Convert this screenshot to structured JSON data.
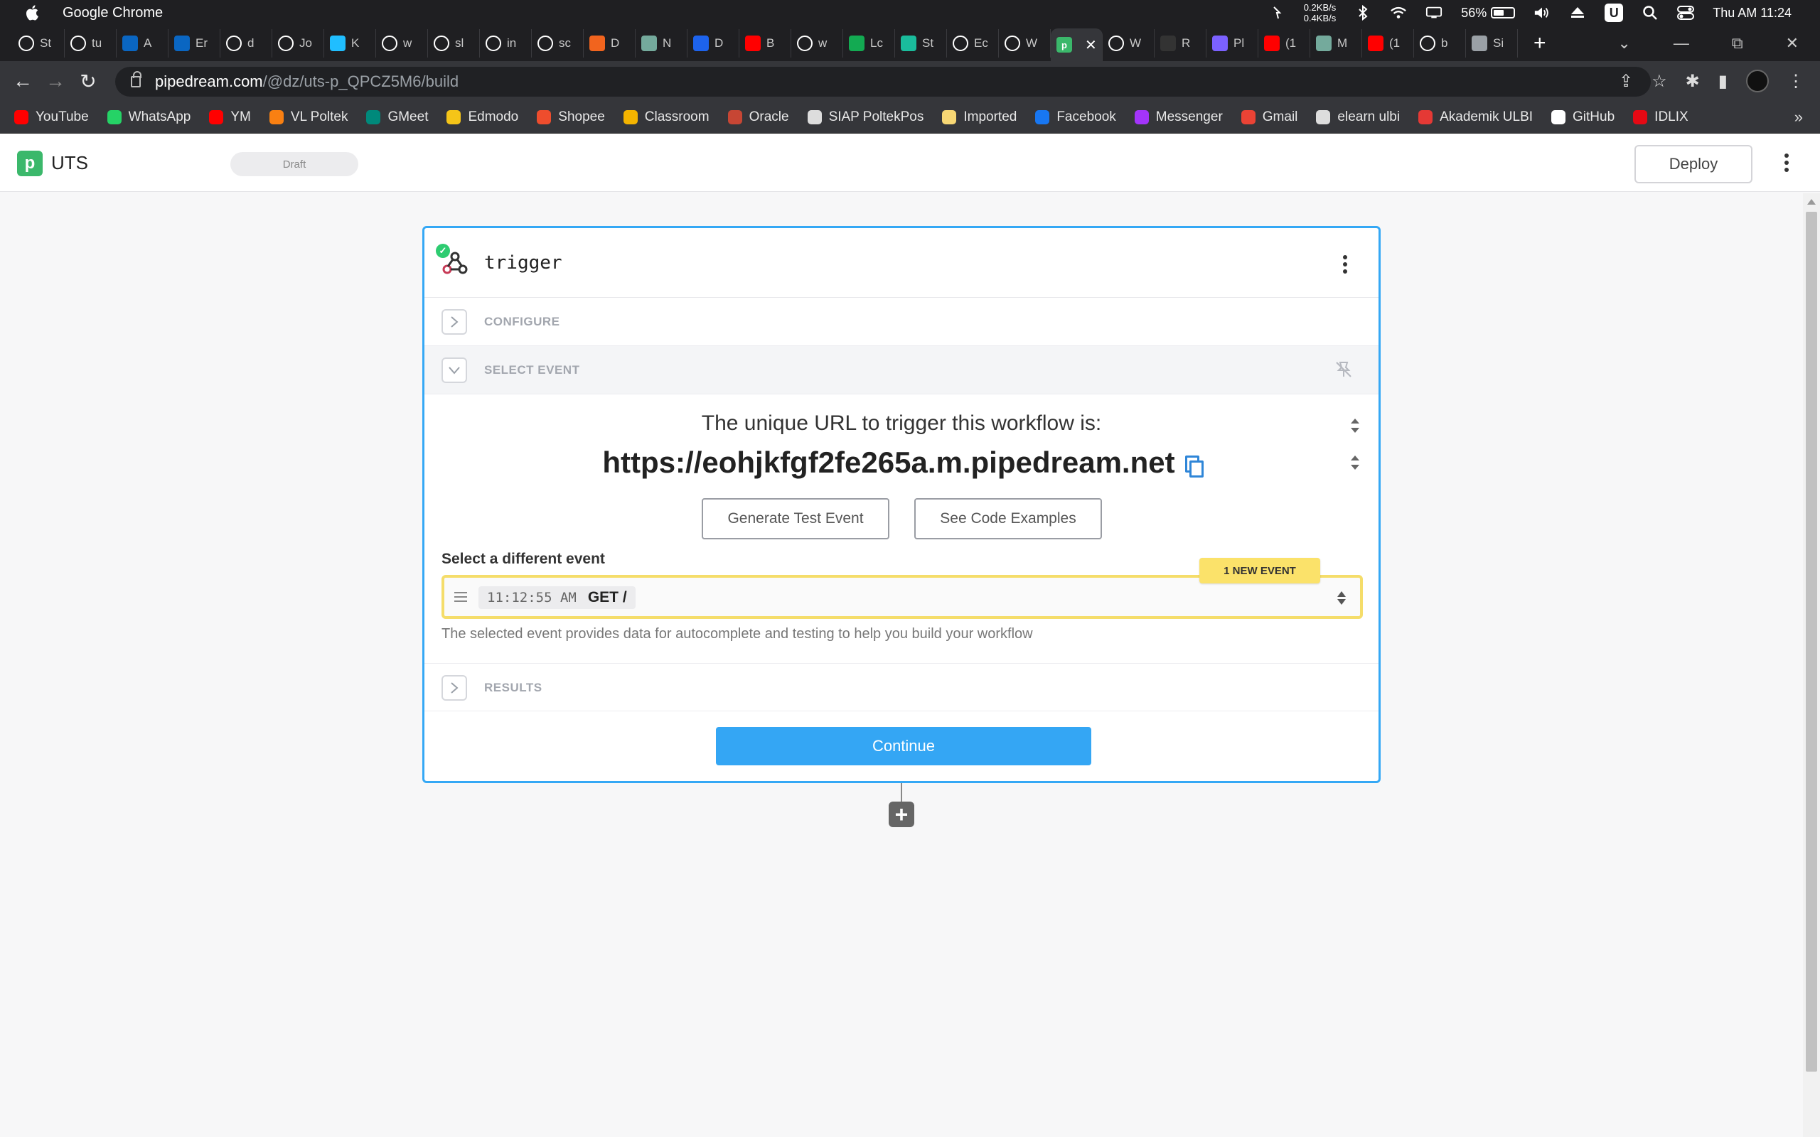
{
  "menubar": {
    "app_name": "Google Chrome",
    "net_up": "0.2KB/s",
    "net_down": "0.4KB/s",
    "battery": "56%",
    "clock": "Thu AM 11:24"
  },
  "tabs": [
    {
      "label": "St",
      "icon": "medium-icon",
      "color": "#ffffff"
    },
    {
      "label": "tu",
      "icon": "github-icon",
      "color": "#ffffff"
    },
    {
      "label": "A",
      "icon": "linkedin-icon",
      "color": "#0a66c2"
    },
    {
      "label": "Er",
      "icon": "linkedin-icon",
      "color": "#0a66c2"
    },
    {
      "label": "d",
      "icon": "github-icon",
      "color": "#ffffff"
    },
    {
      "label": "Jo",
      "icon": "github-icon",
      "color": "#ffffff"
    },
    {
      "label": "K",
      "icon": "kaggle-icon",
      "color": "#20beff"
    },
    {
      "label": "w",
      "icon": "github-icon",
      "color": "#ffffff"
    },
    {
      "label": "sl",
      "icon": "google-icon",
      "color": "#ffffff"
    },
    {
      "label": "in",
      "icon": "github-icon",
      "color": "#ffffff"
    },
    {
      "label": "sc",
      "icon": "google-icon",
      "color": "#ffffff"
    },
    {
      "label": "D",
      "icon": "etsy-icon",
      "color": "#f1641e"
    },
    {
      "label": "N",
      "icon": "openai-icon",
      "color": "#74aa9c"
    },
    {
      "label": "D",
      "icon": "docker-icon",
      "color": "#1d63ed"
    },
    {
      "label": "B",
      "icon": "youtube-icon",
      "color": "#ff0000"
    },
    {
      "label": "w",
      "icon": "github-icon",
      "color": "#ffffff"
    },
    {
      "label": "Lc",
      "icon": "leaf-icon",
      "color": "#13aa52"
    },
    {
      "label": "St",
      "icon": "diamond-icon",
      "color": "#1abc9c"
    },
    {
      "label": "Ec",
      "icon": "github-icon",
      "color": "#ffffff"
    },
    {
      "label": "W",
      "icon": "github-icon",
      "color": "#ffffff"
    },
    {
      "label": "",
      "icon": "pipedream-icon",
      "color": "#3bb86b"
    },
    {
      "label": "W",
      "icon": "github-icon",
      "color": "#ffffff"
    },
    {
      "label": "R",
      "icon": "circle-icon",
      "color": "#333333"
    },
    {
      "label": "Pl",
      "icon": "planet-icon",
      "color": "#7b61ff"
    },
    {
      "label": "(1",
      "icon": "youtube-icon",
      "color": "#ff0000"
    },
    {
      "label": "M",
      "icon": "openai-icon",
      "color": "#74aa9c"
    },
    {
      "label": "(1",
      "icon": "youtube-icon",
      "color": "#ff0000"
    },
    {
      "label": "b",
      "icon": "github-icon",
      "color": "#ffffff"
    },
    {
      "label": "Si",
      "icon": "globe-icon",
      "color": "#9aa0a6"
    }
  ],
  "address": {
    "domain": "pipedream.com",
    "path": "/@dz/uts-p_QPCZ5M6/build"
  },
  "bookmarks": [
    {
      "label": "YouTube",
      "icon": "youtube-icon",
      "color": "#ff0000"
    },
    {
      "label": "WhatsApp",
      "icon": "whatsapp-icon",
      "color": "#25d366"
    },
    {
      "label": "YM",
      "icon": "youtube-music-icon",
      "color": "#ff0000"
    },
    {
      "label": "VL Poltek",
      "icon": "moodle-icon",
      "color": "#f98012"
    },
    {
      "label": "GMeet",
      "icon": "meet-icon",
      "color": "#00897b"
    },
    {
      "label": "Edmodo",
      "icon": "edmodo-icon",
      "color": "#f5c518"
    },
    {
      "label": "Shopee",
      "icon": "shopee-icon",
      "color": "#ee4d2d"
    },
    {
      "label": "Classroom",
      "icon": "classroom-icon",
      "color": "#f4b400"
    },
    {
      "label": "Oracle",
      "icon": "oracle-icon",
      "color": "#c74634"
    },
    {
      "label": "SIAP PoltekPos",
      "icon": "siap-icon",
      "color": "#dddddd"
    },
    {
      "label": "Imported",
      "icon": "folder-icon",
      "color": "#f7d774"
    },
    {
      "label": "Facebook",
      "icon": "facebook-icon",
      "color": "#1877f2"
    },
    {
      "label": "Messenger",
      "icon": "messenger-icon",
      "color": "#a334fa"
    },
    {
      "label": "Gmail",
      "icon": "gmail-icon",
      "color": "#ea4335"
    },
    {
      "label": "elearn ulbi",
      "icon": "page-icon",
      "color": "#dddddd"
    },
    {
      "label": "Akademik ULBI",
      "icon": "ulbi-icon",
      "color": "#e53935"
    },
    {
      "label": "GitHub",
      "icon": "github-icon",
      "color": "#ffffff"
    },
    {
      "label": "IDLIX",
      "icon": "idlix-icon",
      "color": "#e50914"
    }
  ],
  "app": {
    "title": "UTS",
    "status": "Draft",
    "deploy_label": "Deploy"
  },
  "trigger": {
    "title": "trigger",
    "configure_label": "CONFIGURE",
    "select_event_label": "SELECT EVENT",
    "results_label": "RESULTS",
    "url_intro": "The unique URL to trigger this workflow is:",
    "url": "https://eohjkfgf2fe265a.m.pipedream.net",
    "generate_label": "Generate Test Event",
    "examples_label": "See Code Examples",
    "select_different_label": "Select a different event",
    "new_event_badge": "1 NEW EVENT",
    "event_time": "11:12:55 AM",
    "event_request": "GET /",
    "help_text": "The selected event provides data for autocomplete and testing to help you build your workflow",
    "continue_label": "Continue"
  },
  "colors": {
    "accent": "#34a6f4",
    "highlight": "#fbe26a",
    "success": "#2ecc71",
    "brand": "#3bb86b"
  }
}
